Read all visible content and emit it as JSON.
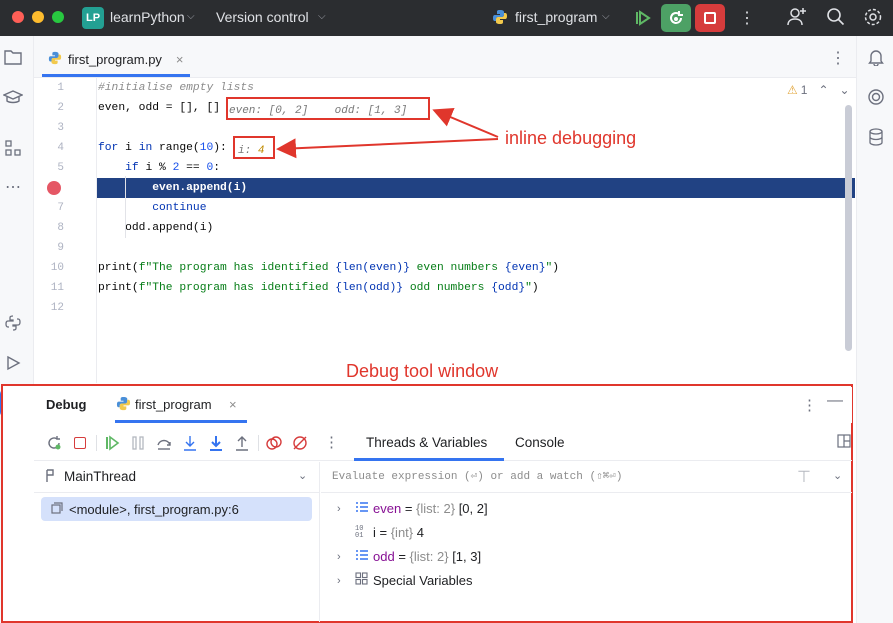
{
  "titlebar": {
    "project_badge": "LP",
    "project_name": "learnPython",
    "vcs": "Version control",
    "run_config": "first_program"
  },
  "editor": {
    "tab_label": "first_program.py",
    "warnings_count": "1",
    "line_numbers": [
      "1",
      "2",
      "3",
      "4",
      "5",
      "",
      "7",
      "8",
      "9",
      "10",
      "11",
      "12"
    ],
    "lines": {
      "l1": "#initialise empty lists",
      "l2": "even, odd = [], []",
      "l4a": "for",
      "l4b": " i ",
      "l4c": "in",
      "l4d": " range(",
      "l4e": "10",
      "l4f": "):",
      "l5a": "    if",
      "l5b": " i % ",
      "l5c": "2",
      "l5d": " == ",
      "l5e": "0",
      "l5f": ":",
      "l6": "        even.append(i)",
      "l7": "        continue",
      "l8": "    odd.append(i)",
      "l10a": "print(",
      "l10b": "f\"The program has identified ",
      "l10c": "{len(even)}",
      "l10d": " even numbers ",
      "l10e": "{even}",
      "l10f": "\"",
      "l10g": ")",
      "l11a": "print(",
      "l11b": "f\"The program has identified ",
      "l11c": "{len(odd)}",
      "l11d": " odd numbers ",
      "l11e": "{odd}",
      "l11f": "\"",
      "l11g": ")"
    },
    "hint_line2_even": "even: [0, 2]",
    "hint_line2_odd": "odd: [1, 3]",
    "hint_line4_label": "i: ",
    "hint_line4_value": "4"
  },
  "annotations": {
    "inline": "inline debugging",
    "debug_window": "Debug tool window"
  },
  "debug": {
    "title": "Debug",
    "session_tab": "first_program",
    "tabs": [
      "Threads & Variables",
      "Console"
    ],
    "thread_select": "MainThread",
    "frame": "<module>, first_program.py:6",
    "evaluate_placeholder": "Evaluate expression (⏎) or add a watch (⇧⌘⏎)",
    "variables": [
      {
        "name": "even",
        "type": "{list: 2}",
        "value": "[0, 2]"
      },
      {
        "name": "i",
        "type": "{int}",
        "value": "4"
      },
      {
        "name": "odd",
        "type": "{list: 2}",
        "value": "[1, 3]"
      },
      {
        "name": "Special Variables"
      }
    ]
  },
  "colors": {
    "accent": "#3574f0",
    "annotation_red": "#e0362c",
    "exec_line": "#214283",
    "breakpoint": "#e55765"
  }
}
